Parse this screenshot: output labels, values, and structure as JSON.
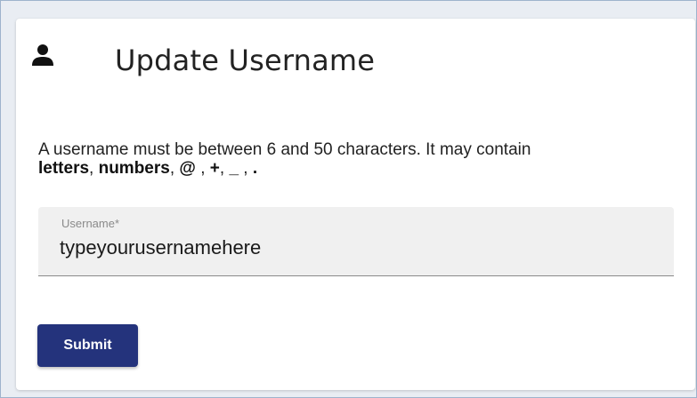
{
  "header": {
    "icon": "person-icon",
    "title": "Update Username"
  },
  "description": {
    "text": "A username must be between 6 and 50 characters. It may contain",
    "letters": "letters",
    "sep1": ", ",
    "numbers": "numbers",
    "sep2": ", ",
    "at": "@",
    "sep3": " , ",
    "plus": "+",
    "sep4": ", ",
    "underscore": "_",
    "sep5": " , ",
    "dot": "."
  },
  "username_field": {
    "label": "Username*",
    "value": "typeyourusernamehere"
  },
  "submit_button": {
    "label": "Submit"
  },
  "colors": {
    "button": "#24337c",
    "field_bg": "#f0f0f0"
  }
}
